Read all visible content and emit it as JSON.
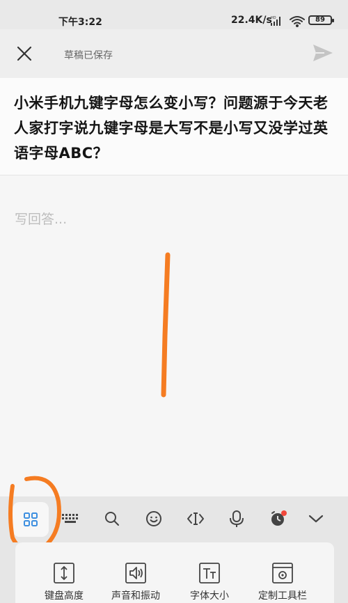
{
  "status_bar": {
    "time": "下午3:22",
    "network_speed": "22.4K/s",
    "battery": "89",
    "icons": [
      "hd-signal-icon",
      "wifi-icon",
      "battery-icon"
    ]
  },
  "top_bar": {
    "draft_status": "草稿已保存",
    "icons": [
      "close-icon",
      "send-icon"
    ]
  },
  "question": {
    "text": "小米手机九键字母怎么变小写？问题源于今天老人家打字说九键字母是大写不是小写又没学过英语字母ABC？"
  },
  "answer": {
    "placeholder": "写回答..."
  },
  "keyboard_toolbar": {
    "tools": [
      "grid-menu-icon",
      "keyboard-icon",
      "search-icon",
      "emoji-icon",
      "cursor-move-icon",
      "microphone-icon",
      "clock-icon",
      "chevron-down-icon"
    ],
    "active_tool": "grid-menu-icon",
    "accent_color": "#3d8fe0",
    "notification_dot_color": "#f0473b"
  },
  "panel": {
    "items": [
      {
        "label": "键盘高度",
        "icon": "keyboard-height-icon"
      },
      {
        "label": "声音和振动",
        "icon": "sound-vibration-icon"
      },
      {
        "label": "字体大小",
        "icon": "font-size-icon"
      },
      {
        "label": "定制工具栏",
        "icon": "custom-toolbar-icon"
      }
    ]
  },
  "annotation_color": "#f57c22"
}
